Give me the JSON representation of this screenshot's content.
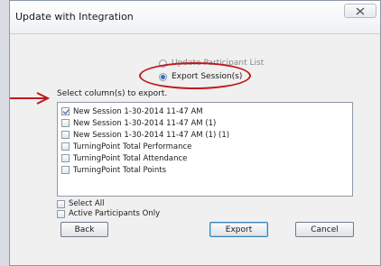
{
  "window": {
    "title": "Update with Integration"
  },
  "mode": {
    "options": [
      {
        "label": "Update Participant List",
        "selected": false
      },
      {
        "label": "Export Session(s)",
        "selected": true
      }
    ]
  },
  "columns": {
    "label": "Select column(s) to export.",
    "items": [
      {
        "label": "New Session 1-30-2014 11-47 AM",
        "checked": true
      },
      {
        "label": "New Session 1-30-2014 11-47 AM (1)",
        "checked": false
      },
      {
        "label": "New Session 1-30-2014 11-47 AM (1) (1)",
        "checked": false
      },
      {
        "label": "TurningPoint Total Performance",
        "checked": false
      },
      {
        "label": "TurningPoint Total Attendance",
        "checked": false
      },
      {
        "label": "TurningPoint Total Points",
        "checked": false
      }
    ]
  },
  "options": {
    "select_all": "Select All",
    "active_only": "Active Participants Only"
  },
  "buttons": {
    "back": "Back",
    "export": "Export",
    "cancel": "Cancel"
  },
  "colors": {
    "annotation": "#c0181e",
    "accent": "#2f6fd1"
  }
}
